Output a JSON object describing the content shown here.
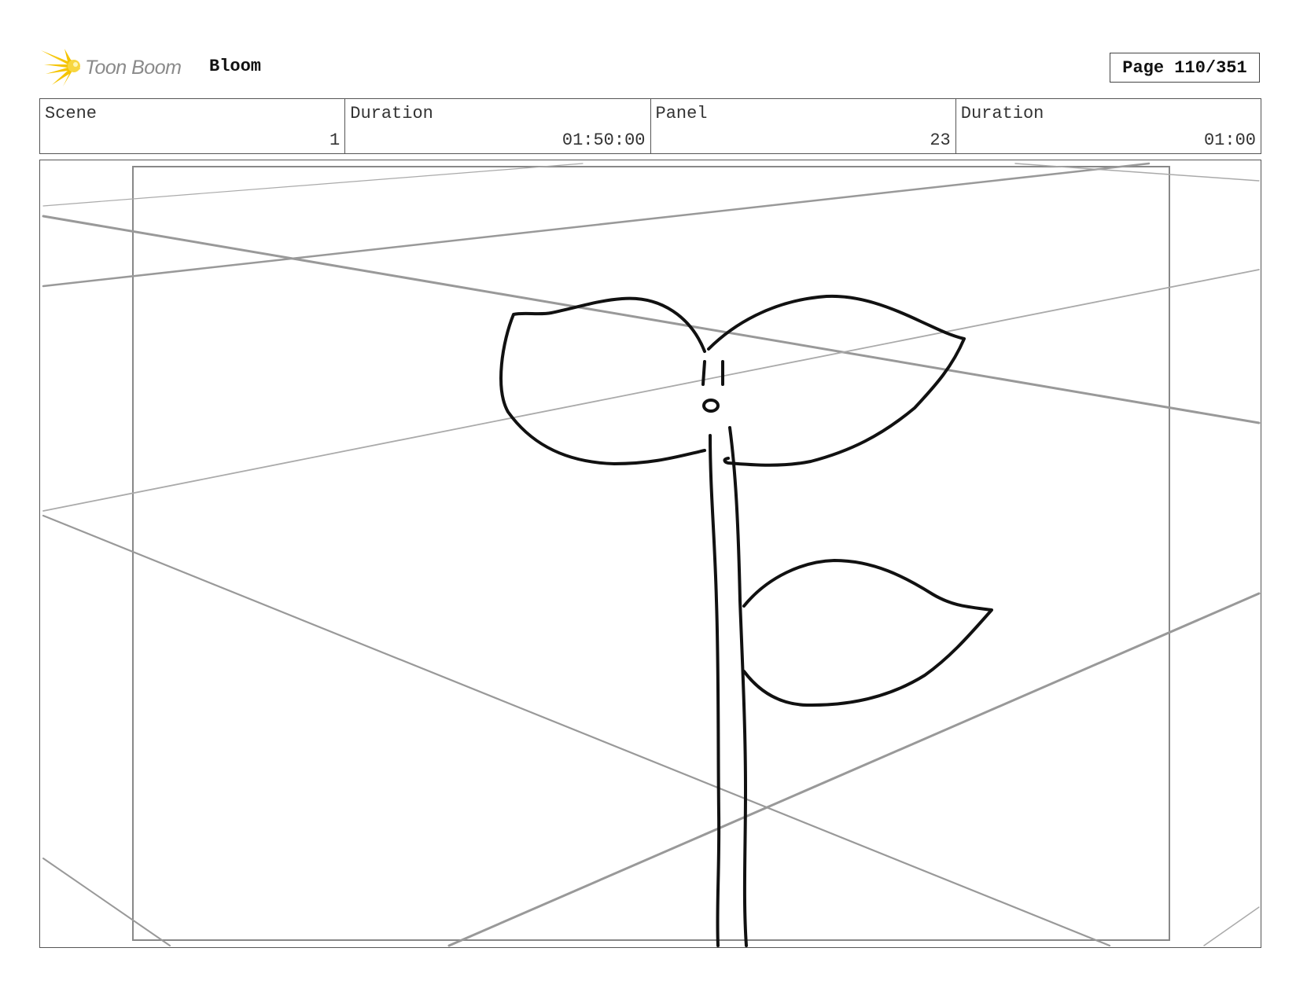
{
  "header": {
    "logo_text": "Toon Boom",
    "project_title": "Bloom",
    "page_label": "Page 110/351",
    "brand_color": "#f5c400"
  },
  "info": {
    "scene_label": "Scene",
    "scene_value": "1",
    "scene_duration_label": "Duration",
    "scene_duration_value": "01:50:00",
    "panel_label": "Panel",
    "panel_value": "23",
    "panel_duration_label": "Duration",
    "panel_duration_value": "01:00"
  },
  "panel": {
    "content": "sketch of a sprouting plant with two top leaves, a face, and a side leaf over perspective guide lines"
  }
}
